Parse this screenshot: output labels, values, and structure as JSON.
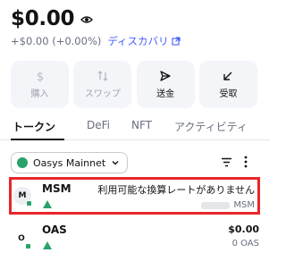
{
  "wallet": {
    "balance": "$0.00",
    "change": "+$0.00 (+0.00%)",
    "discover_label": "ディスカバリ"
  },
  "actions": [
    {
      "label": "購入",
      "icon": "dollar-icon",
      "enabled": false
    },
    {
      "label": "スワップ",
      "icon": "swap-icon",
      "enabled": false
    },
    {
      "label": "送金",
      "icon": "send-icon",
      "enabled": true
    },
    {
      "label": "受取",
      "icon": "receive-icon",
      "enabled": true
    }
  ],
  "tabs": [
    {
      "label": "トークン",
      "active": true
    },
    {
      "label": "DeFi",
      "active": false
    },
    {
      "label": "NFT",
      "active": false
    },
    {
      "label": "アクティビティ",
      "active": false
    }
  ],
  "network": {
    "name": "Oasys Mainnet"
  },
  "tokens": [
    {
      "avatar": "M",
      "symbol": "MSM",
      "right_top": "利用可能な換算レートがありません",
      "right_bottom": "MSM",
      "highlighted": true
    },
    {
      "avatar": "O",
      "symbol": "OAS",
      "right_top": "$0.00",
      "right_bottom": "0 OAS",
      "highlighted": false
    }
  ],
  "colors": {
    "accent": "#4459ff",
    "highlight_border": "#e8262a",
    "network_green": "#29a36a",
    "action_bg": "#f3f5f9"
  }
}
